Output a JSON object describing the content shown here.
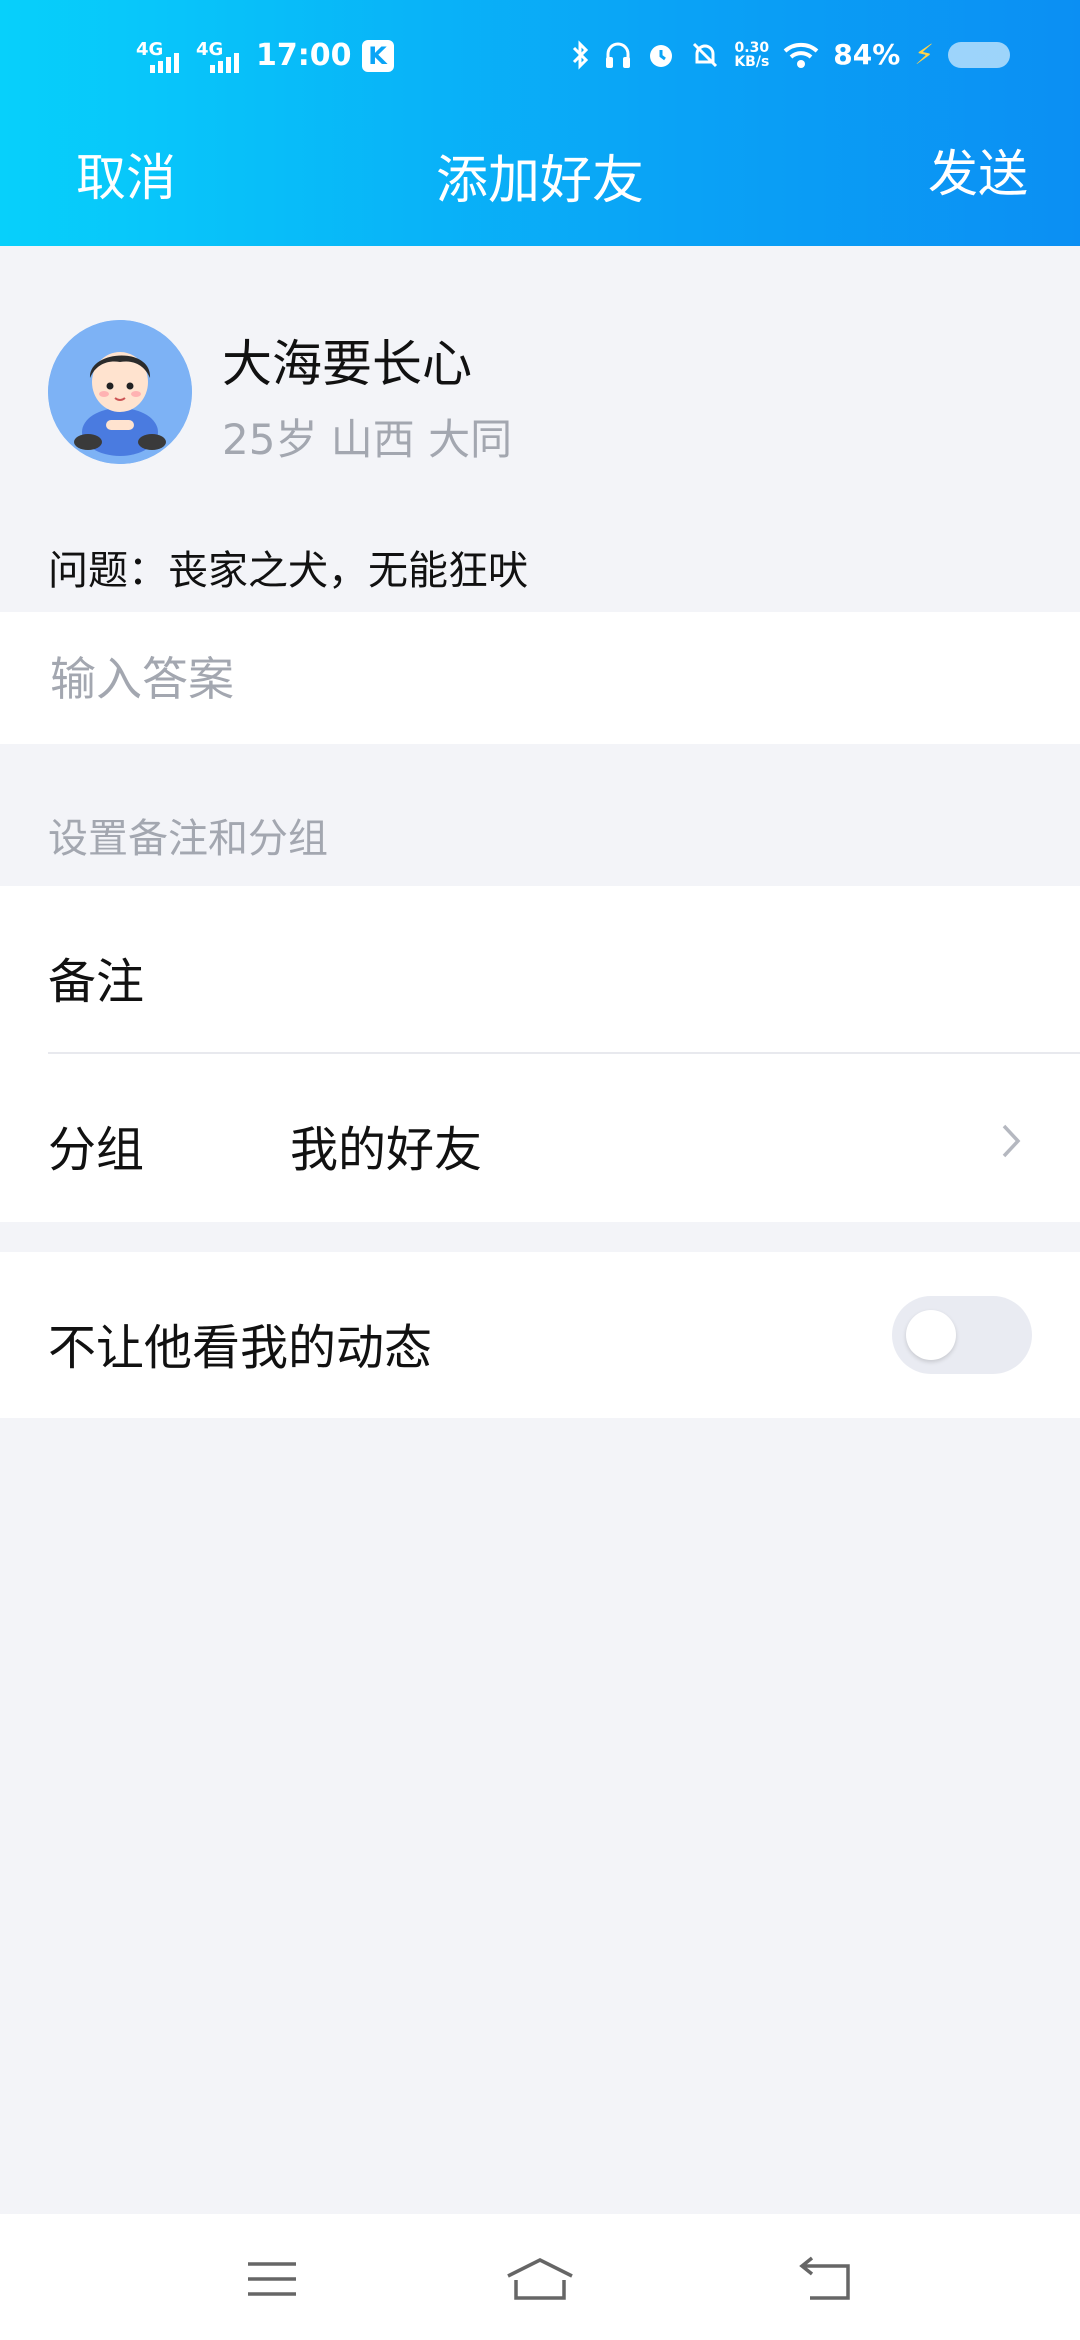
{
  "status_bar": {
    "network1": "4G",
    "network2": "4G",
    "time": "17:00",
    "app_badge": "K",
    "speed_value": "0.30",
    "speed_unit": "KB/s",
    "battery": "84%"
  },
  "nav": {
    "cancel": "取消",
    "title": "添加好友",
    "send": "发送"
  },
  "profile": {
    "name": "大海要长心",
    "meta": "25岁  山西 大同",
    "question": "问题：丧家之犬，无能狂吠"
  },
  "answer": {
    "placeholder": "输入答案",
    "value": ""
  },
  "settings_section": {
    "label": "设置备注和分组"
  },
  "remark_row": {
    "label": "备注",
    "value": ""
  },
  "group_row": {
    "label": "分组",
    "value": "我的好友"
  },
  "privacy_row": {
    "label": "不让他看我的动态",
    "enabled": false
  },
  "colors": {
    "header_start": "#07d0fb",
    "header_end": "#0b8ff3",
    "background": "#f3f4f8",
    "muted_text": "#a3a7b0"
  }
}
